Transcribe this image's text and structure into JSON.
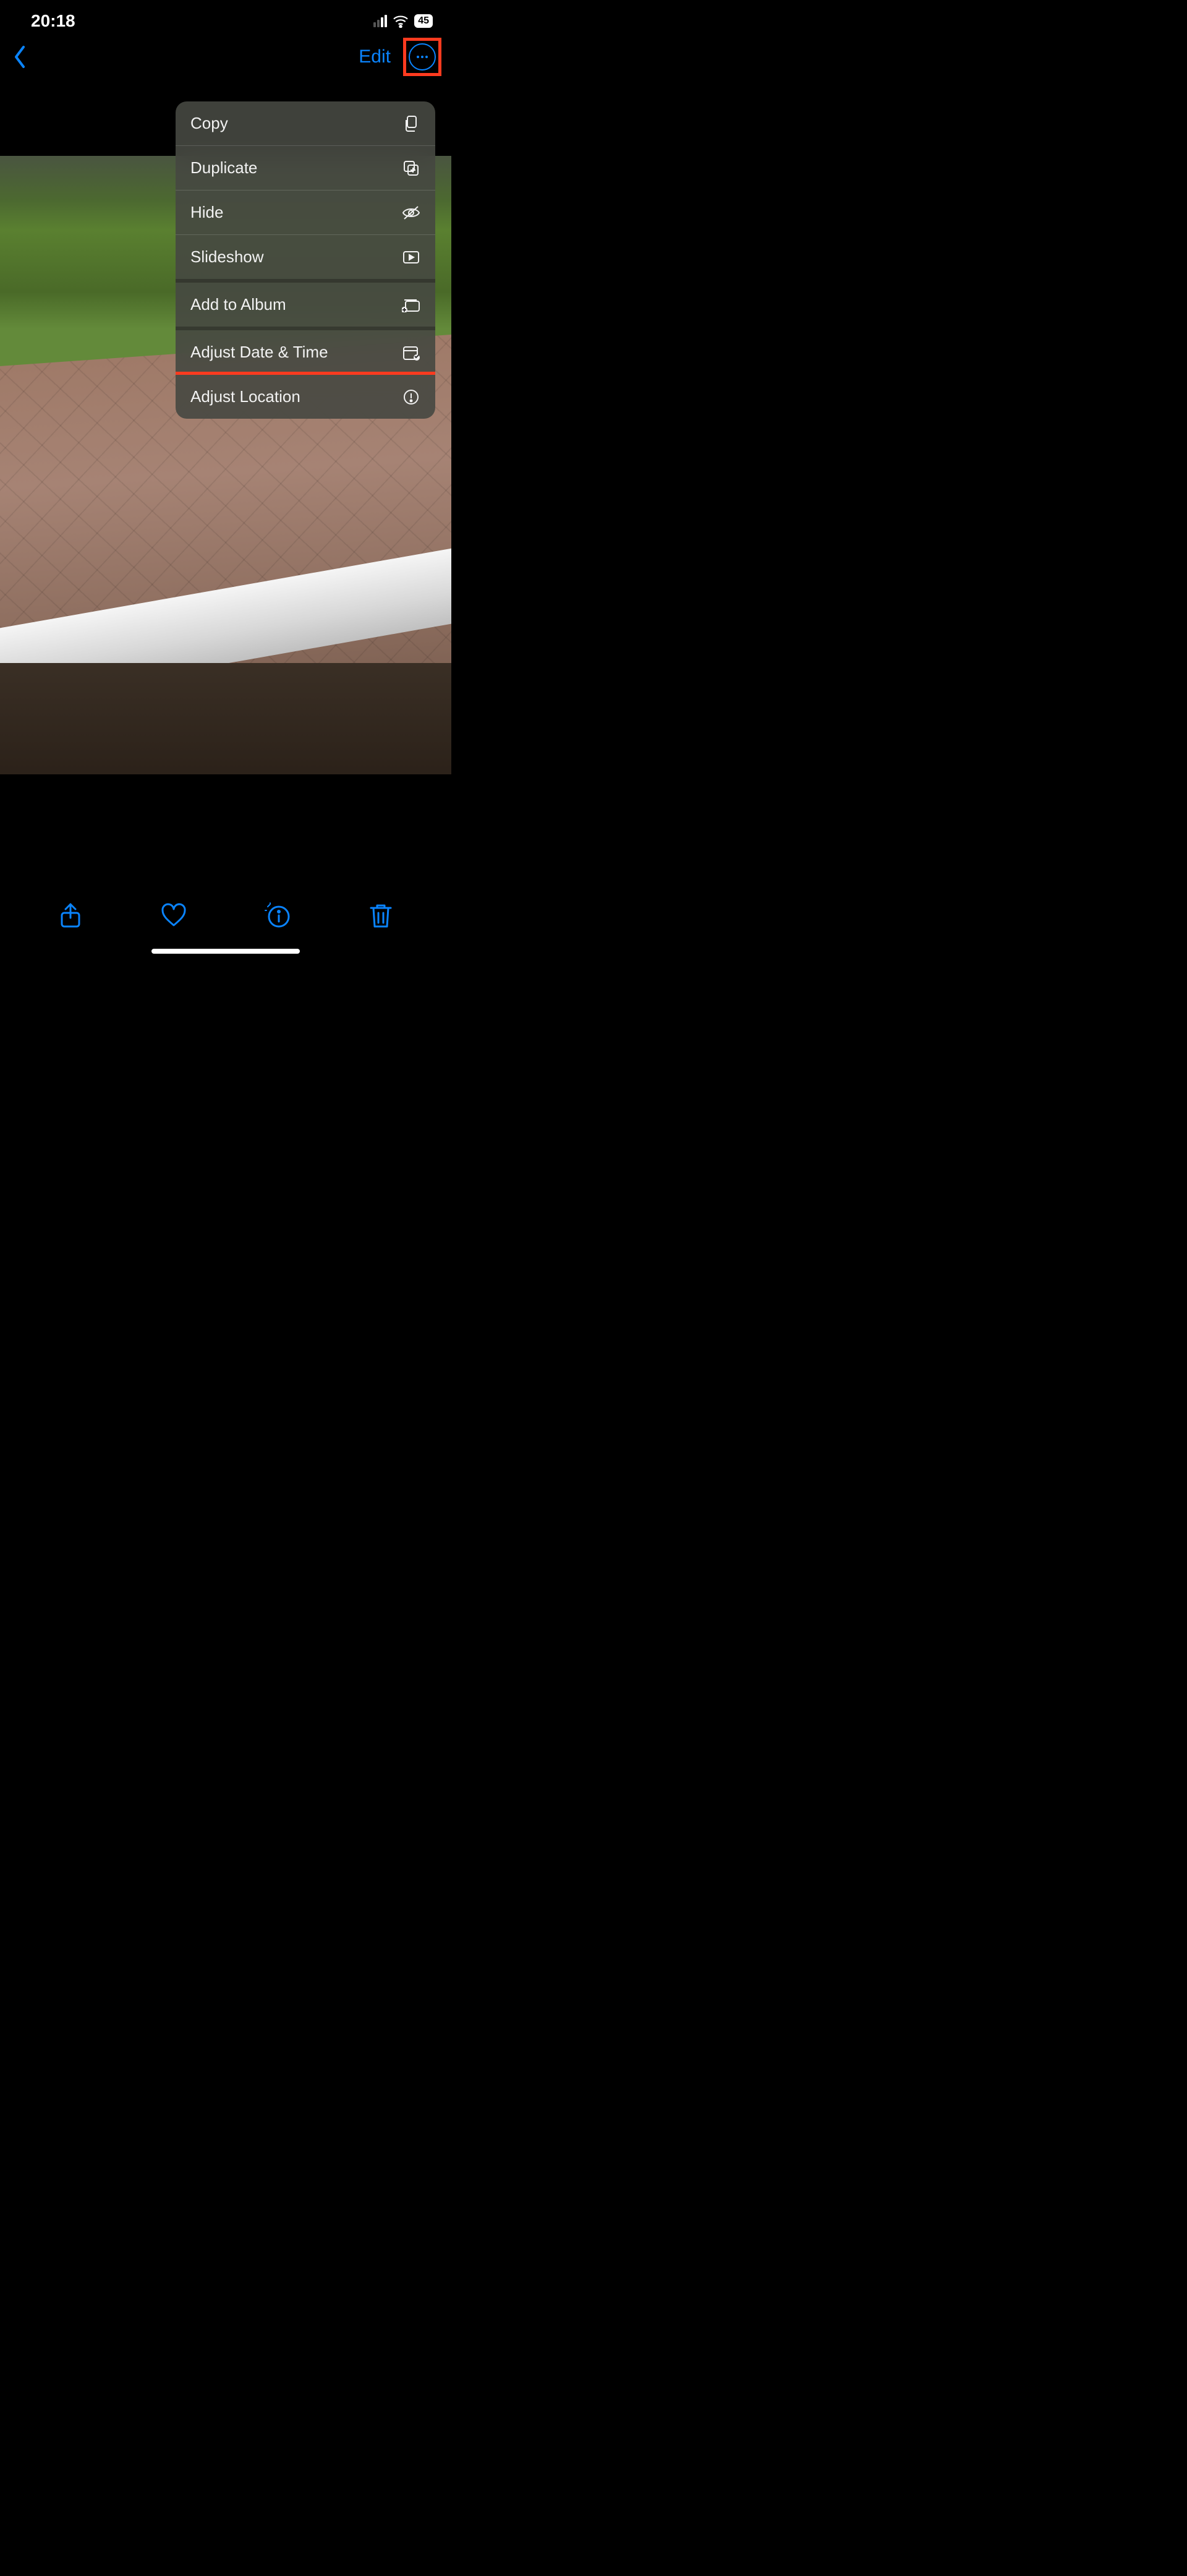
{
  "status": {
    "time": "20:18",
    "battery": "45"
  },
  "nav": {
    "edit_label": "Edit"
  },
  "context_menu": {
    "items": [
      {
        "label": "Copy",
        "icon": "copy-icon"
      },
      {
        "label": "Duplicate",
        "icon": "duplicate-icon"
      },
      {
        "label": "Hide",
        "icon": "hide-icon"
      },
      {
        "label": "Slideshow",
        "icon": "slideshow-icon"
      },
      {
        "label": "Add to Album",
        "icon": "add-to-album-icon"
      },
      {
        "label": "Adjust Date & Time",
        "icon": "adjust-date-icon"
      },
      {
        "label": "Adjust Location",
        "icon": "adjust-location-icon"
      }
    ]
  },
  "annotations": {
    "highlight_color": "#ff3b1f",
    "highlighted": [
      "more-button",
      "menu-adjust-location"
    ]
  },
  "colors": {
    "accent": "#0a84ff",
    "background": "#000000"
  }
}
